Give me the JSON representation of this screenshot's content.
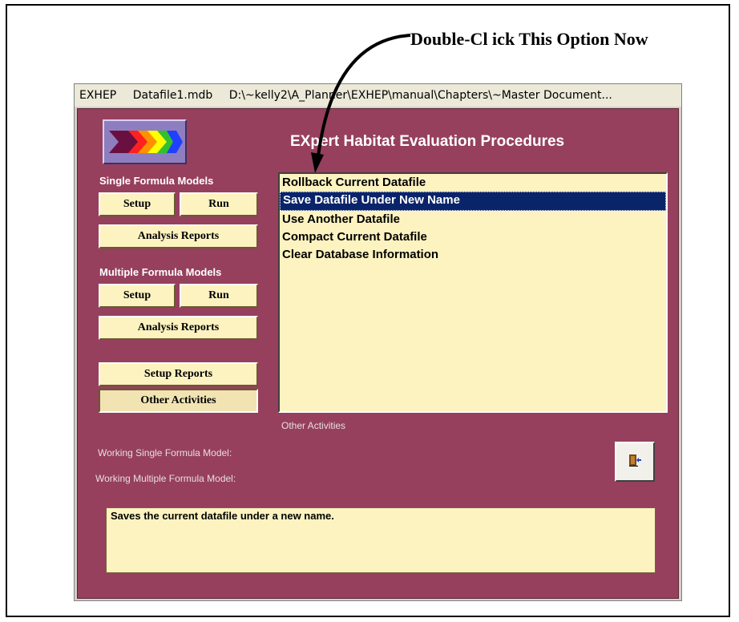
{
  "annotation": {
    "text": "Double-Cl ick This Option Now"
  },
  "window": {
    "title_parts": [
      "EXHEP",
      "Datafile1.mdb",
      "D:\\~kelly2\\A_Planner\\EXHEP\\manual\\Chapters\\~Master Document..."
    ]
  },
  "app": {
    "title": "EXpert Habitat Evaluation Procedures",
    "logo_icon": "arrows-logo-icon",
    "colors": {
      "background": "#96405e",
      "button": "#fdf3c0",
      "selection": "#0a246a"
    }
  },
  "single": {
    "label": "Single Formula Models",
    "setup": "Setup",
    "run": "Run",
    "reports": "Analysis Reports"
  },
  "multiple": {
    "label": "Multiple Formula Models",
    "setup": "Setup",
    "run": "Run",
    "reports": "Analysis Reports"
  },
  "setup_reports": "Setup Reports",
  "other_activities": "Other Activities",
  "list": {
    "items": [
      "Rollback Current Datafile",
      "Save Datafile Under New Name",
      "Use Another Datafile",
      "Compact Current Datafile",
      "Clear Database Information"
    ],
    "selected_index": 1,
    "caption": "Other Activities"
  },
  "labels": {
    "working_single": "Working Single Formula Model:",
    "working_multiple": "Working Multiple Formula Model:"
  },
  "exit_icon": "exit-door-icon",
  "status": "Saves the current datafile under a new name."
}
